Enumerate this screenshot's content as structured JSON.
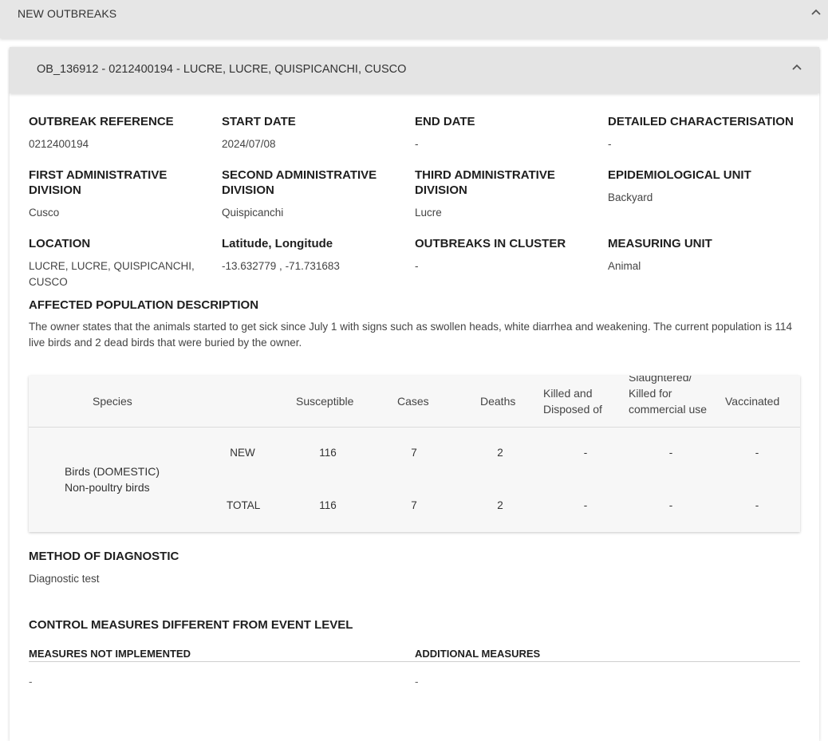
{
  "outbreaks_panel": {
    "title": "NEW OUTBREAKS"
  },
  "outbreak": {
    "header": "OB_136912 - 0212400194 - LUCRE, LUCRE, QUISPICANCHI, CUSCO",
    "fields": {
      "outbreak_reference": {
        "label": "OUTBREAK REFERENCE",
        "value": "0212400194"
      },
      "start_date": {
        "label": "START DATE",
        "value": "2024/07/08"
      },
      "end_date": {
        "label": "END DATE",
        "value": "-"
      },
      "detailed_characterisation": {
        "label": "DETAILED CHARACTERISATION",
        "value": "-"
      },
      "first_admin": {
        "label": "FIRST ADMINISTRATIVE DIVISION",
        "value": "Cusco"
      },
      "second_admin": {
        "label": "SECOND ADMINISTRATIVE DIVISION",
        "value": "Quispicanchi"
      },
      "third_admin": {
        "label": "THIRD ADMINISTRATIVE DIVISION",
        "value": "Lucre"
      },
      "epi_unit": {
        "label": "EPIDEMIOLOGICAL UNIT",
        "value": "Backyard"
      },
      "location": {
        "label": "LOCATION",
        "value": "LUCRE, LUCRE, QUISPICANCHI, CUSCO"
      },
      "lat_long": {
        "label": "Latitude, Longitude",
        "value": "-13.632779 , -71.731683"
      },
      "outbreaks_in_cluster": {
        "label": "OUTBREAKS IN CLUSTER",
        "value": "-"
      },
      "measuring_unit": {
        "label": "MEASURING UNIT",
        "value": "Animal"
      }
    },
    "affected_population": {
      "label": "AFFECTED POPULATION DESCRIPTION",
      "text": "The owner states that the animals started to get sick since July 1 with signs such as swollen heads, white diarrhea and weakening. The current population is 114 live birds and 2 dead birds that were buried by the owner."
    },
    "table": {
      "headers": {
        "species": "Species",
        "susceptible": "Susceptible",
        "cases": "Cases",
        "deaths": "Deaths",
        "killed_disposed": "Killed and Disposed of",
        "slaughtered": "Slaughtered/ Killed for commercial use",
        "vaccinated": "Vaccinated"
      },
      "species_name": "Birds (DOMESTIC) Non-poultry birds",
      "rows": [
        {
          "type": "NEW",
          "susceptible": "116",
          "cases": "7",
          "deaths": "2",
          "killed_disposed": "-",
          "slaughtered": "-",
          "vaccinated": "-"
        },
        {
          "type": "TOTAL",
          "susceptible": "116",
          "cases": "7",
          "deaths": "2",
          "killed_disposed": "-",
          "slaughtered": "-",
          "vaccinated": "-"
        }
      ]
    },
    "method_of_diagnostic": {
      "label": "METHOD OF DIAGNOSTIC",
      "value": "Diagnostic test"
    },
    "control_measures": {
      "label": "CONTROL MEASURES DIFFERENT FROM EVENT LEVEL",
      "not_implemented_label": "MEASURES NOT IMPLEMENTED",
      "not_implemented_value": "-",
      "additional_label": "ADDITIONAL MEASURES",
      "additional_value": "-"
    }
  }
}
